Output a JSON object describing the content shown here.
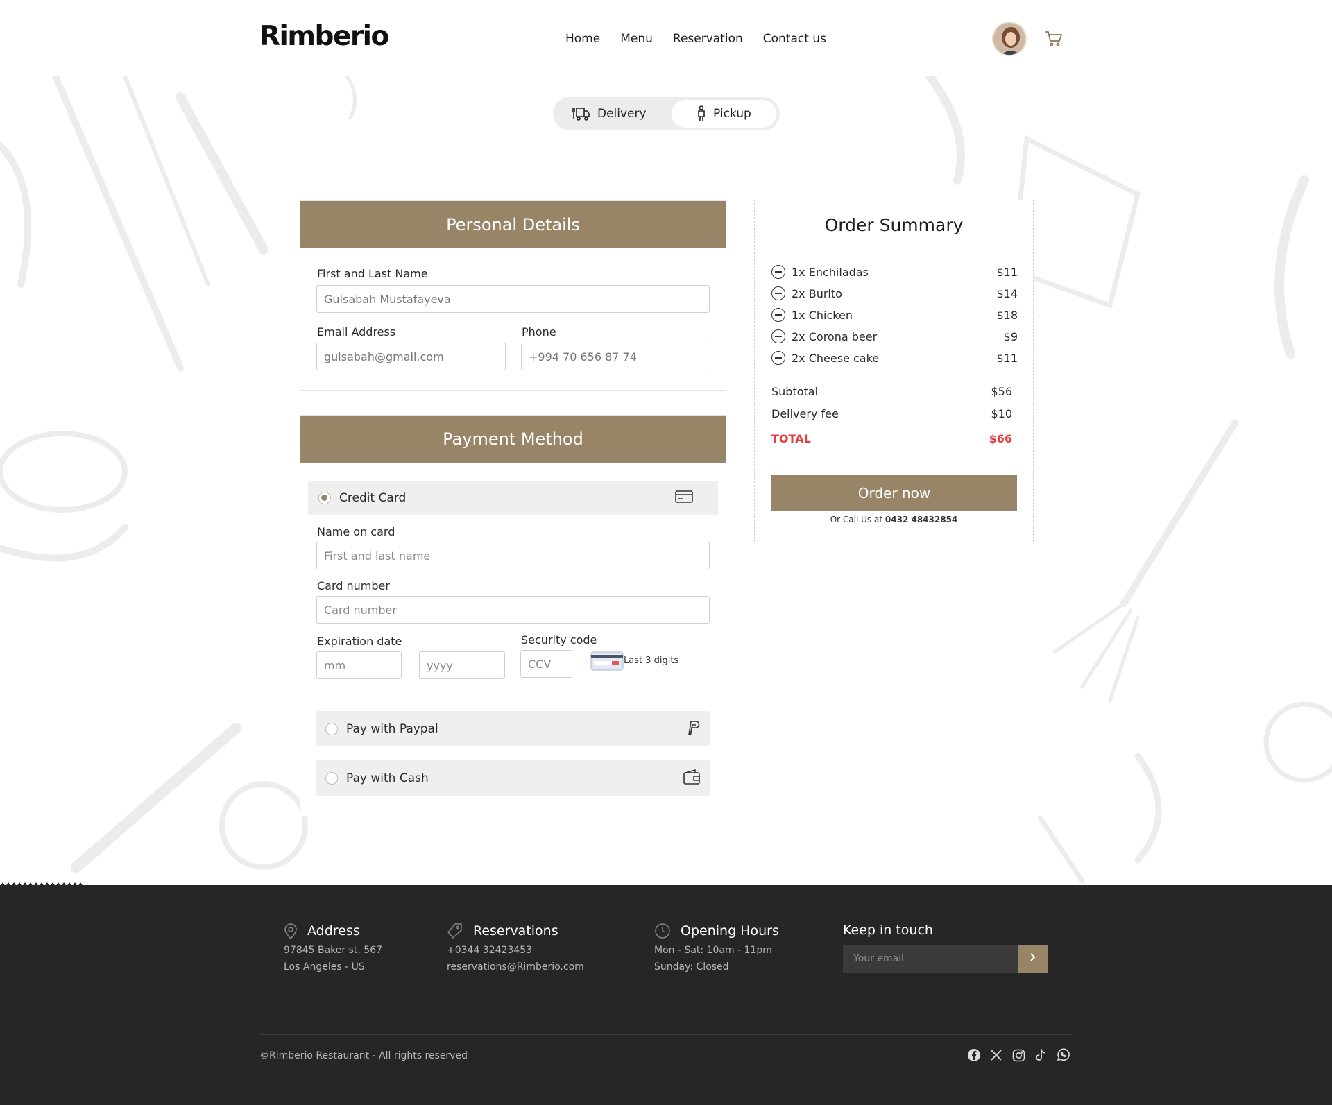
{
  "brand": {
    "logo": "Rimberio"
  },
  "nav": {
    "items": [
      "Home",
      "Menu",
      "Reservation",
      "Contact us"
    ]
  },
  "toggle": {
    "delivery": "Delivery",
    "pickup": "Pickup",
    "selected": "Pickup"
  },
  "personal": {
    "title": "Personal Details",
    "name_label": "First and Last Name",
    "name_value": "Gulsabah Mustafayeva",
    "email_label": "Email Address",
    "email_value": "gulsabah@gmail.com",
    "phone_label": "Phone",
    "phone_value": "+994 70 656 87 74"
  },
  "payment": {
    "title": "Payment Method",
    "credit_label": "Credit Card",
    "name_on_card_label": "Name on card",
    "name_on_card_placeholder": "First and last name",
    "card_number_label": "Card number",
    "card_number_placeholder": "Card number",
    "expiration_label": "Expiration date",
    "mm_placeholder": "mm",
    "yyyy_placeholder": "yyyy",
    "security_label": "Security code",
    "ccv_placeholder": "CCV",
    "ccv_hint": "Last 3 digits",
    "paypal_label": "Pay with Paypal",
    "cash_label": "Pay with Cash",
    "selected": "Credit Card"
  },
  "summary": {
    "title": "Order Summary",
    "items": [
      {
        "name": "1x Enchiladas",
        "price": "$11"
      },
      {
        "name": "2x Burito",
        "price": "$14"
      },
      {
        "name": "1x Chicken",
        "price": "$18"
      },
      {
        "name": "2x Corona beer",
        "price": "$9"
      },
      {
        "name": "2x Cheese cake",
        "price": "$11"
      }
    ],
    "subtotal_label": "Subtotal",
    "subtotal_value": "$56",
    "fee_label": "Delivery fee",
    "fee_value": "$10",
    "total_label": "TOTAL",
    "total_value": "$66",
    "order_button": "Order now",
    "call_prefix": "Or Call Us at",
    "call_number": "0432 48432854"
  },
  "footer": {
    "address_title": "Address",
    "address_line1": "97845 Baker st. 567",
    "address_line2": "Los Angeles - US",
    "reservations_title": "Reservations",
    "reservations_line1": "+0344 32423453",
    "reservations_line2": "reservations@Rimberio.com",
    "hours_title": "Opening Hours",
    "hours_line1": "Mon - Sat: 10am - 11pm",
    "hours_line2": "Sunday: Closed",
    "newsletter_title": "Keep in touch",
    "newsletter_placeholder": "Your email",
    "copyright": "©Rimberio Restaurant - All rights reserved",
    "socials": [
      "facebook-icon",
      "x-icon",
      "instagram-icon",
      "tiktok-icon",
      "whatsapp-icon"
    ]
  },
  "colors": {
    "accent": "#988567",
    "total": "#e33d3d",
    "footer_bg": "#262626"
  }
}
